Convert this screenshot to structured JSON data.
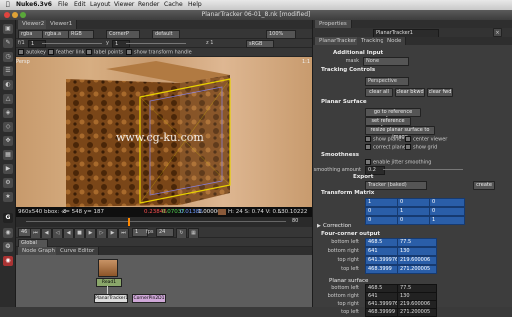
{
  "menubar": {
    "app": "Nuke6.3v6",
    "items": [
      "File",
      "Edit",
      "Layout",
      "Viewer",
      "Render",
      "Cache",
      "Help"
    ]
  },
  "window": {
    "title": "PlanarTracker 06-01_8.nk [modified]"
  },
  "viewer": {
    "tabs": [
      "Viewer2",
      "Viewer1"
    ],
    "channels": "rgba",
    "layer": "rgba.a",
    "colorspace": "RGB",
    "input": "CornerP",
    "mode": "default",
    "zoom": "100%",
    "gain_label": "f/1",
    "gain": "1",
    "gamma_label": "y",
    "gamma": "1",
    "lut": "sRGB",
    "frame_label": "z 1",
    "options": [
      "autokey",
      "feather link",
      "label points",
      "show transform handle"
    ],
    "persp": "Persp",
    "right_label": "1:1",
    "watermark": "www.cg-ku.com",
    "status_res": "960x540 bbox: -3",
    "status_xy": "x= 548 y= 187",
    "pixel_values": [
      "0.23846",
      "0.07037",
      "0.01386",
      "1.00000"
    ],
    "hsv": "H: 24 S: 0.74 V: 0.53",
    "lum": "L: 0.10222",
    "frame": "46",
    "fps_label": "fps",
    "fps": "24",
    "range_end": "80",
    "playback_mode": "Global",
    "counter": "1"
  },
  "nodegraph": {
    "tabs": [
      "Node Graph",
      "Curve Editor"
    ],
    "nodes": [
      "Read1",
      "PlanarTracker1",
      "CornerPin2D1"
    ]
  },
  "properties": {
    "title": "Properties",
    "node_name": "PlanarTracker1",
    "tabs": [
      "PlanarTracker",
      "Tracking",
      "Node"
    ],
    "additional_input": "Additional Input",
    "mask_label": "mask",
    "mask_value": "None",
    "tracking_controls": "Tracking Controls",
    "track_mode": "Perspective",
    "clear_all": "clear all",
    "clear_bkwd": "clear bkwd",
    "clear_fwd": "clear fwd",
    "planar_surface": "Planar Surface",
    "go_ref": "go to reference frame",
    "set_ref": "set reference frame",
    "resize": "resize planar surface to image",
    "show_plane": "show plane",
    "center_viewer": "center viewer",
    "correct_plane": "correct plane",
    "show_grid": "show grid",
    "smoothness": "Smoothness",
    "enable_jitter": "enable jitter smoothing",
    "smoothing_amount": "smoothing amount",
    "smoothing_value": "0.2",
    "export": "Export",
    "export_type": "Tracker (baked)",
    "create": "create",
    "transform_matrix": "Transform Matrix",
    "matrix": [
      [
        "1",
        "0",
        "0"
      ],
      [
        "0",
        "1",
        "0"
      ],
      [
        "0",
        "0",
        "1"
      ]
    ],
    "correction": "Correction",
    "four_corner": "Four-corner output",
    "corners": [
      {
        "label": "bottom left",
        "x": "468.5",
        "y": "77.5"
      },
      {
        "label": "bottom right",
        "x": "641",
        "y": "130"
      },
      {
        "label": "top right",
        "x": "641.399976",
        "y": "219.600006"
      },
      {
        "label": "top left",
        "x": "468.3999",
        "y": "271.200005"
      }
    ],
    "planar_surface2": "Planar surface",
    "corners2": [
      {
        "label": "bottom left",
        "x": "468.5",
        "y": "77.5"
      },
      {
        "label": "bottom right",
        "x": "641",
        "y": "130"
      },
      {
        "label": "top right",
        "x": "641.399976",
        "y": "219.600006"
      },
      {
        "label": "top left",
        "x": "468.39999",
        "y": "271.200005"
      }
    ]
  },
  "colors": {
    "accent_blue": "#2a5ea8",
    "wood": "#d2a87a",
    "plane_outline": "#e8d200",
    "node_read": "#8aa66a"
  }
}
